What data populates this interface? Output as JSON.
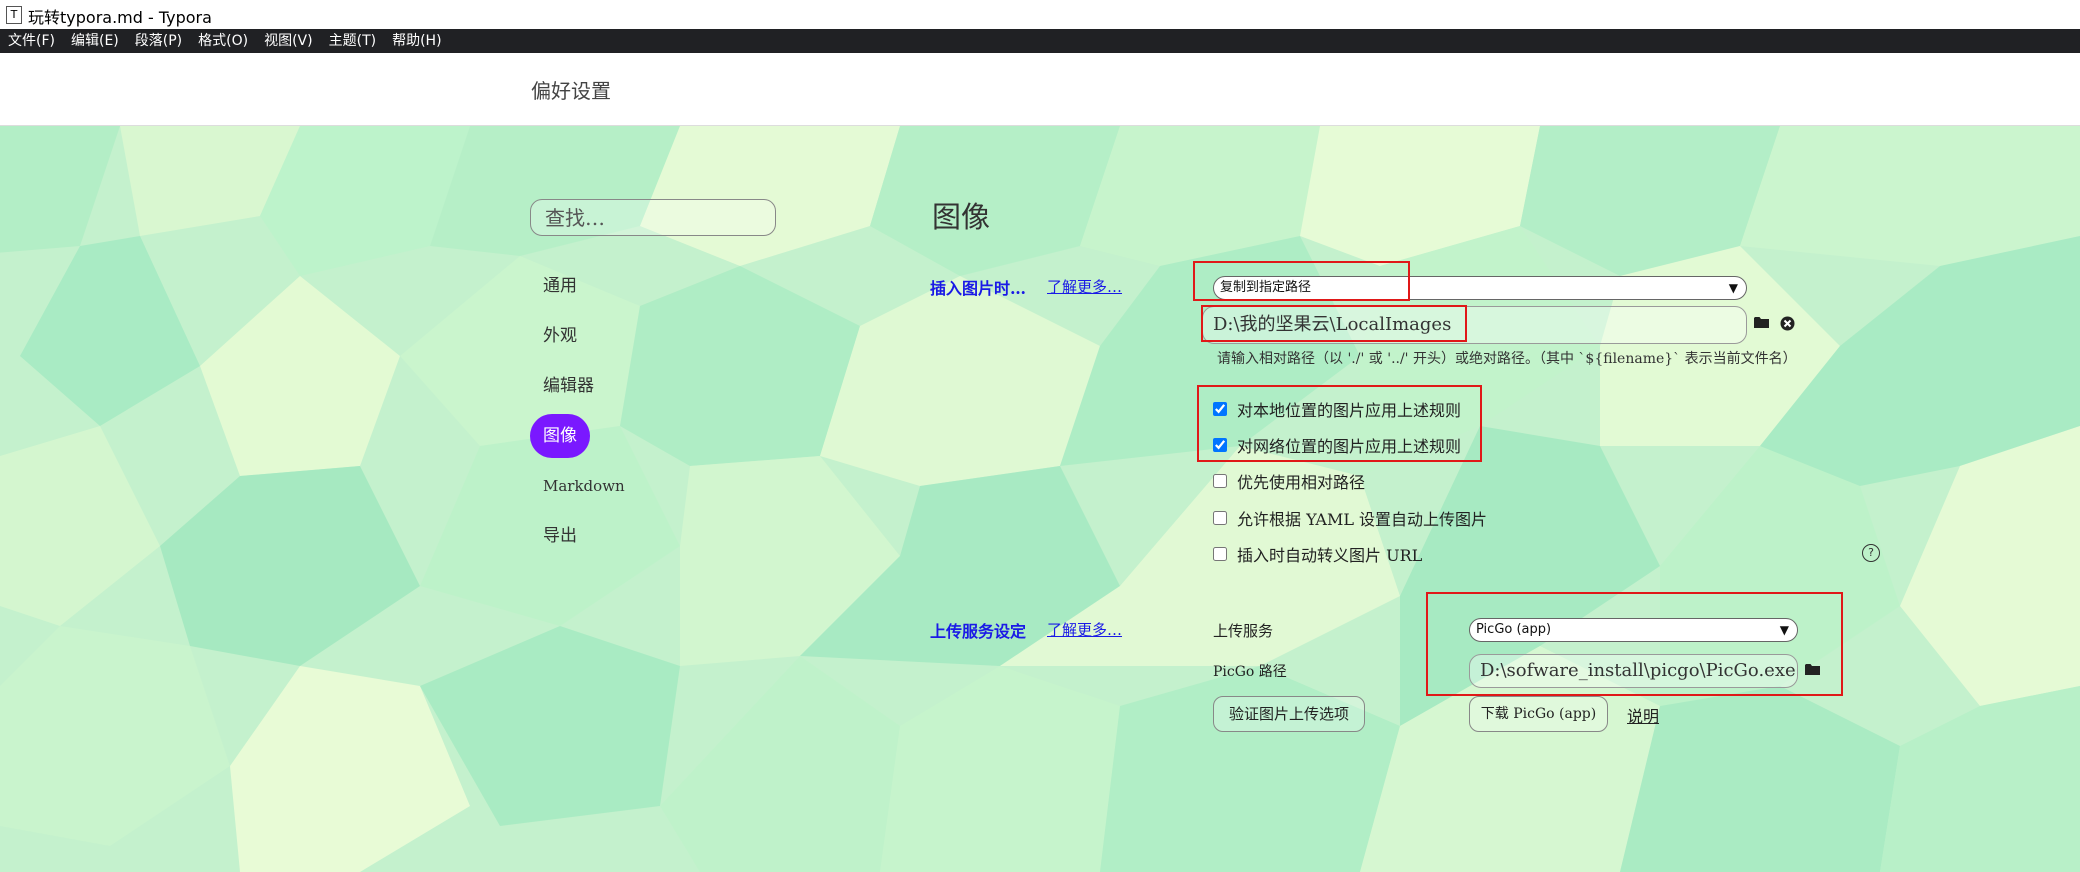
{
  "window": {
    "title": "玩转typora.md - Typora",
    "icon": "T"
  },
  "menubar": [
    "文件(F)",
    "编辑(E)",
    "段落(P)",
    "格式(O)",
    "视图(V)",
    "主题(T)",
    "帮助(H)"
  ],
  "header": {
    "title": "偏好设置"
  },
  "sidebar": {
    "search_placeholder": "查找…",
    "items": [
      {
        "label": "通用"
      },
      {
        "label": "外观"
      },
      {
        "label": "编辑器"
      },
      {
        "label": "图像"
      },
      {
        "label": "Markdown"
      },
      {
        "label": "导出"
      }
    ],
    "active": "图像"
  },
  "main": {
    "title": "图像",
    "insert": {
      "label": "插入图片时…",
      "learn_more": "了解更多…",
      "action_value": "复制到指定路径",
      "path_value": "D:\\我的坚果云\\LocalImages",
      "hint": "请输入相对路径（以 './' 或 '../' 开头）或绝对路径。（其中 `${filename}` 表示当前文件名）",
      "options": [
        {
          "label": "对本地位置的图片应用上述规则",
          "checked": true
        },
        {
          "label": "对网络位置的图片应用上述规则",
          "checked": true
        },
        {
          "label": "优先使用相对路径",
          "checked": false
        },
        {
          "label": "允许根据 YAML 设置自动上传图片",
          "checked": false
        },
        {
          "label": "插入时自动转义图片 URL",
          "checked": false
        }
      ]
    },
    "upload": {
      "label": "上传服务设定",
      "learn_more": "了解更多…",
      "service_label": "上传服务",
      "service_value": "PicGo (app)",
      "picgo_path_label": "PicGo 路径",
      "picgo_path_value": "D:\\sofware_install\\picgo\\PicGo.exe",
      "verify_button": "验证图片上传选项",
      "download_button": "下载 PicGo (app)",
      "explain_link": "说明"
    }
  },
  "colors": {
    "accent": "#7a18ff",
    "link": "#1a1ae6",
    "highlight": "#e01818"
  }
}
